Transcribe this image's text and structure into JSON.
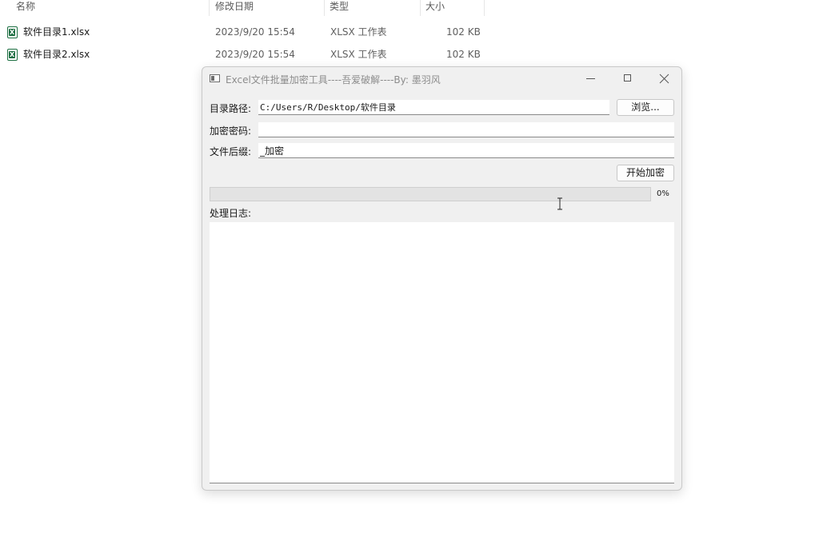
{
  "explorer": {
    "columns": [
      "名称",
      "修改日期",
      "类型",
      "大小"
    ],
    "files": [
      {
        "name": "软件目录1.xlsx",
        "modified": "2023/9/20 15:54",
        "type": "XLSX 工作表",
        "size": "102 KB",
        "icon": "excel-file-icon"
      },
      {
        "name": "软件目录2.xlsx",
        "modified": "2023/9/20 15:54",
        "type": "XLSX 工作表",
        "size": "102 KB",
        "icon": "excel-file-icon"
      }
    ]
  },
  "window": {
    "title": "Excel文件批量加密工具----吾爱破解----By:  墨羽风",
    "labels": {
      "dir": "目录路径:",
      "password": "加密密码:",
      "suffix": "文件后缀:",
      "log": "处理日志:"
    },
    "inputs": {
      "dir_value": "C:/Users/R/Desktop/软件目录",
      "password_value": "",
      "suffix_value": "_加密"
    },
    "buttons": {
      "browse": "浏览...",
      "start": "开始加密"
    },
    "progress": {
      "value": 0,
      "text": "0%"
    },
    "log_text": ""
  },
  "colors": {
    "window_bg": "#f0f0f0",
    "excel_green": "#1d6f42",
    "title_text": "#8c8c8c"
  }
}
